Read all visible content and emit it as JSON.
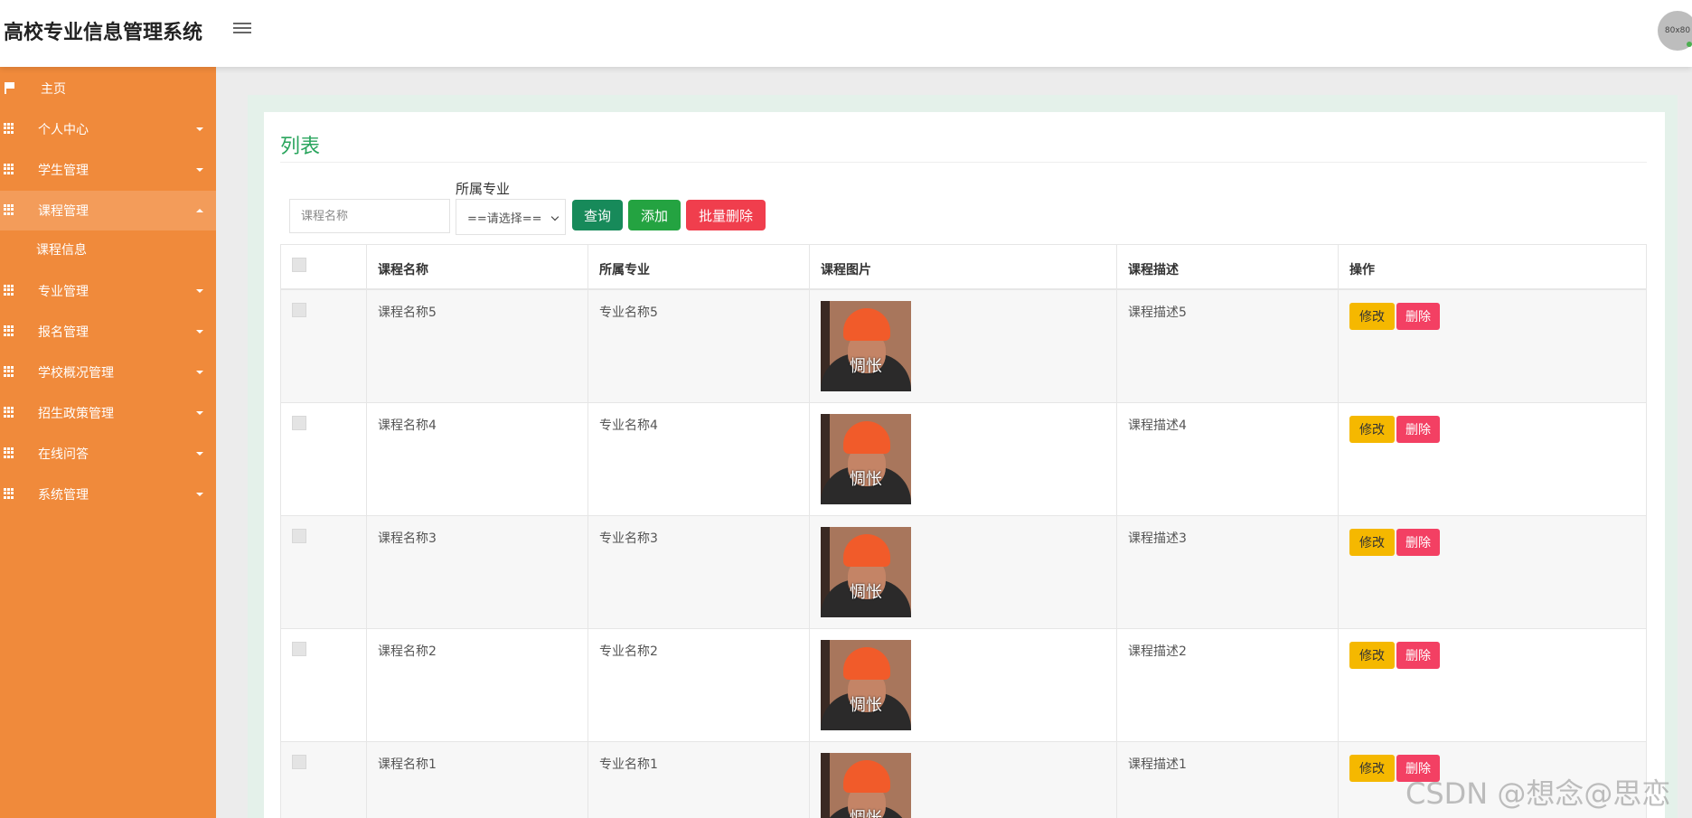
{
  "app": {
    "title": "高校专业信息管理系统",
    "avatar_text": "80x80"
  },
  "sidebar": {
    "items": [
      {
        "label": "主页",
        "icon": "flag-icon"
      },
      {
        "label": "个人中心",
        "icon": "grid-icon"
      },
      {
        "label": "学生管理",
        "icon": "grid-icon"
      },
      {
        "label": "课程管理",
        "icon": "grid-icon",
        "expanded": true
      },
      {
        "label": "专业管理",
        "icon": "grid-icon"
      },
      {
        "label": "报名管理",
        "icon": "grid-icon"
      },
      {
        "label": "学校概况管理",
        "icon": "grid-icon"
      },
      {
        "label": "招生政策管理",
        "icon": "grid-icon"
      },
      {
        "label": "在线问答",
        "icon": "grid-icon"
      },
      {
        "label": "系统管理",
        "icon": "grid-icon"
      }
    ],
    "sub_items": [
      {
        "label": "课程信息"
      }
    ]
  },
  "panel": {
    "title": "列表"
  },
  "filters": {
    "course_name_placeholder": "课程名称",
    "major_label": "所属专业",
    "major_select_value": "==请选择==",
    "query_label": "查询",
    "add_label": "添加",
    "batch_delete_label": "批量删除"
  },
  "table": {
    "columns": [
      "课程名称",
      "所属专业",
      "课程图片",
      "课程描述",
      "操作"
    ],
    "rows": [
      {
        "course_name": "课程名称5",
        "major": "专业名称5",
        "image_caption": "惆怅",
        "description": "课程描述5"
      },
      {
        "course_name": "课程名称4",
        "major": "专业名称4",
        "image_caption": "惆怅",
        "description": "课程描述4"
      },
      {
        "course_name": "课程名称3",
        "major": "专业名称3",
        "image_caption": "惆怅",
        "description": "课程描述3"
      },
      {
        "course_name": "课程名称2",
        "major": "专业名称2",
        "image_caption": "惆怅",
        "description": "课程描述2"
      },
      {
        "course_name": "课程名称1",
        "major": "专业名称1",
        "image_caption": "惆怅",
        "description": "课程描述1"
      }
    ],
    "edit_label": "修改",
    "delete_label": "删除"
  },
  "watermark": "CSDN @想念@思恋",
  "colors": {
    "sidebar": "#f08a3b",
    "accent_green": "#2aa55d",
    "query_btn": "#178a5a",
    "add_btn": "#24a341",
    "delete_btn": "#f03e4d",
    "edit_btn": "#f5b800"
  }
}
